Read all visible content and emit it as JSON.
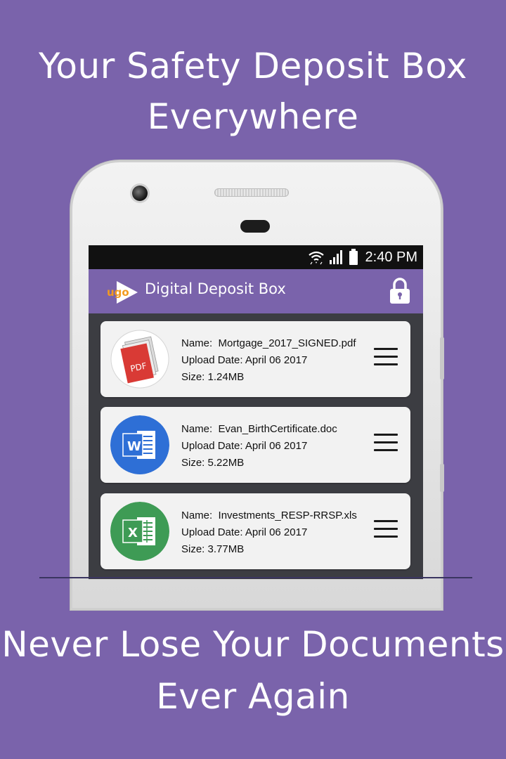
{
  "headline_top": [
    "Your Safety Deposit Box",
    "Everywhere"
  ],
  "headline_bottom": [
    "Never Lose Your Documents",
    "Ever Again"
  ],
  "status_bar": {
    "time": "2:40 PM",
    "icons": [
      "wifi-icon",
      "signal-icon",
      "battery-icon"
    ]
  },
  "app_bar": {
    "logo_text": "ugo",
    "title": "Digital Deposit Box",
    "lock_icon": "lock-icon"
  },
  "colors": {
    "background": "#7a63ab",
    "app_bar": "#7a63ab",
    "card": "#f2f2f2",
    "pdf": "#d93a35",
    "word": "#2e6fd6",
    "excel": "#3e9b55"
  },
  "files": [
    {
      "icon": "pdf-icon",
      "icon_label": "PDF",
      "name_label": "Name:",
      "name": "Mortgage_2017_SIGNED.pdf",
      "date_label": "Upload Date:",
      "date": "April 06 2017",
      "size_label": "Size:",
      "size": "1.24MB"
    },
    {
      "icon": "word-icon",
      "icon_label": "W",
      "name_label": "Name:",
      "name": "Evan_BirthCertificate.doc",
      "date_label": "Upload Date:",
      "date": "April 06 2017",
      "size_label": "Size:",
      "size": "5.22MB"
    },
    {
      "icon": "excel-icon",
      "icon_label": "X",
      "name_label": "Name:",
      "name": "Investments_RESP-RRSP.xls",
      "date_label": "Upload Date:",
      "date": "April 06 2017",
      "size_label": "Size:",
      "size": "3.77MB"
    }
  ]
}
